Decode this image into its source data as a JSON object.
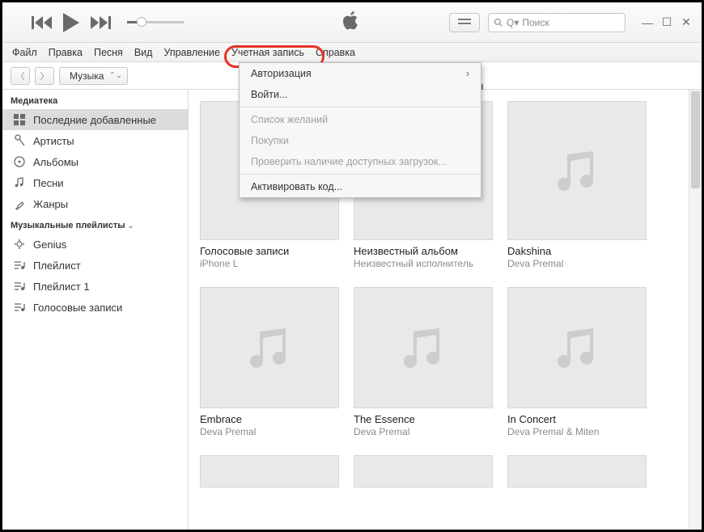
{
  "window": {
    "minimize": "—",
    "maximize": "☐",
    "close": "✕"
  },
  "search": {
    "placeholder": "Поиск",
    "prefix": "Q▾"
  },
  "menubar": {
    "file": "Файл",
    "edit": "Правка",
    "song": "Песня",
    "view": "Вид",
    "controls": "Управление",
    "account": "Учетная запись",
    "help": "Справка"
  },
  "dropdown": {
    "authorize": "Авторизация",
    "signin": "Войти...",
    "wishlist": "Список желаний",
    "purchases": "Покупки",
    "check_downloads": "Проверить наличие доступных загрузок...",
    "redeem": "Активировать код..."
  },
  "library_selector": {
    "label": "Музыка"
  },
  "sidebar": {
    "library_header": "Медиатека",
    "items": [
      {
        "label": "Последние добавленные"
      },
      {
        "label": "Артисты"
      },
      {
        "label": "Альбомы"
      },
      {
        "label": "Песни"
      },
      {
        "label": "Жанры"
      }
    ],
    "playlists_header": "Музыкальные плейлисты",
    "playlists": [
      {
        "label": "Genius"
      },
      {
        "label": "Плейлист"
      },
      {
        "label": "Плейлист 1"
      },
      {
        "label": "Голосовые записи"
      }
    ]
  },
  "visible_header_fragment": "ин",
  "albums": [
    {
      "title": "Голосовые записи",
      "artist": "iPhone L"
    },
    {
      "title": "Неизвестный альбом",
      "artist": "Неизвестный исполнитель"
    },
    {
      "title": "Dakshina",
      "artist": "Deva Premal"
    },
    {
      "title": "Embrace",
      "artist": "Deva Premal"
    },
    {
      "title": "The Essence",
      "artist": "Deva Premal"
    },
    {
      "title": "In Concert",
      "artist": "Deva Premal & Miten"
    }
  ]
}
